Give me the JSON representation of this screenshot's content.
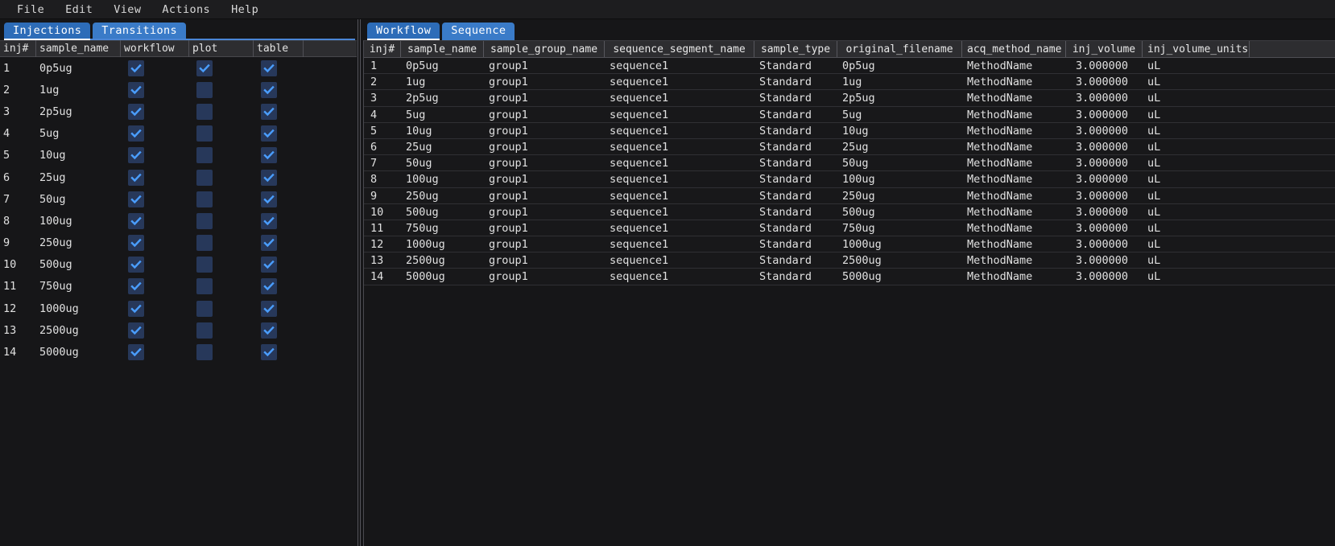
{
  "menubar": {
    "items": [
      "File",
      "Edit",
      "View",
      "Actions",
      "Help"
    ]
  },
  "colors": {
    "window_bg": "#161618",
    "menubar_bg": "#1d1d1f",
    "header_bg": "#2d2d30",
    "tab_active": "#2d6cb8",
    "tab_inactive": "#3a7bc8",
    "accent_line": "#4a86d6",
    "checkbox_bg": "#27385a",
    "check_mark": "#4a9eff",
    "text": "#e0e0e0"
  },
  "left_panel": {
    "tabs": [
      {
        "label": "Injections",
        "active": true
      },
      {
        "label": "Transitions",
        "active": false
      }
    ],
    "table": {
      "columns": [
        "inj#",
        "sample_name",
        "workflow",
        "plot",
        "table"
      ],
      "rows": [
        {
          "inj": "1",
          "sample_name": "0p5ug",
          "workflow": true,
          "plot": true,
          "table": true
        },
        {
          "inj": "2",
          "sample_name": "1ug",
          "workflow": true,
          "plot": false,
          "table": true
        },
        {
          "inj": "3",
          "sample_name": "2p5ug",
          "workflow": true,
          "plot": false,
          "table": true
        },
        {
          "inj": "4",
          "sample_name": "5ug",
          "workflow": true,
          "plot": false,
          "table": true
        },
        {
          "inj": "5",
          "sample_name": "10ug",
          "workflow": true,
          "plot": false,
          "table": true
        },
        {
          "inj": "6",
          "sample_name": "25ug",
          "workflow": true,
          "plot": false,
          "table": true
        },
        {
          "inj": "7",
          "sample_name": "50ug",
          "workflow": true,
          "plot": false,
          "table": true
        },
        {
          "inj": "8",
          "sample_name": "100ug",
          "workflow": true,
          "plot": false,
          "table": true
        },
        {
          "inj": "9",
          "sample_name": "250ug",
          "workflow": true,
          "plot": false,
          "table": true
        },
        {
          "inj": "10",
          "sample_name": "500ug",
          "workflow": true,
          "plot": false,
          "table": true
        },
        {
          "inj": "11",
          "sample_name": "750ug",
          "workflow": true,
          "plot": false,
          "table": true
        },
        {
          "inj": "12",
          "sample_name": "1000ug",
          "workflow": true,
          "plot": false,
          "table": true
        },
        {
          "inj": "13",
          "sample_name": "2500ug",
          "workflow": true,
          "plot": false,
          "table": true
        },
        {
          "inj": "14",
          "sample_name": "5000ug",
          "workflow": true,
          "plot": false,
          "table": true
        }
      ]
    }
  },
  "right_panel": {
    "tabs": [
      {
        "label": "Workflow",
        "active": true
      },
      {
        "label": "Sequence",
        "active": false
      }
    ],
    "table": {
      "columns": [
        "inj#",
        "sample_name",
        "sample_group_name",
        "sequence_segment_name",
        "sample_type",
        "original_filename",
        "acq_method_name",
        "inj_volume",
        "inj_volume_units"
      ],
      "rows": [
        [
          "1",
          "0p5ug",
          "group1",
          "sequence1",
          "Standard",
          "0p5ug",
          "MethodName",
          "3.000000",
          "uL"
        ],
        [
          "2",
          "1ug",
          "group1",
          "sequence1",
          "Standard",
          "1ug",
          "MethodName",
          "3.000000",
          "uL"
        ],
        [
          "3",
          "2p5ug",
          "group1",
          "sequence1",
          "Standard",
          "2p5ug",
          "MethodName",
          "3.000000",
          "uL"
        ],
        [
          "4",
          "5ug",
          "group1",
          "sequence1",
          "Standard",
          "5ug",
          "MethodName",
          "3.000000",
          "uL"
        ],
        [
          "5",
          "10ug",
          "group1",
          "sequence1",
          "Standard",
          "10ug",
          "MethodName",
          "3.000000",
          "uL"
        ],
        [
          "6",
          "25ug",
          "group1",
          "sequence1",
          "Standard",
          "25ug",
          "MethodName",
          "3.000000",
          "uL"
        ],
        [
          "7",
          "50ug",
          "group1",
          "sequence1",
          "Standard",
          "50ug",
          "MethodName",
          "3.000000",
          "uL"
        ],
        [
          "8",
          "100ug",
          "group1",
          "sequence1",
          "Standard",
          "100ug",
          "MethodName",
          "3.000000",
          "uL"
        ],
        [
          "9",
          "250ug",
          "group1",
          "sequence1",
          "Standard",
          "250ug",
          "MethodName",
          "3.000000",
          "uL"
        ],
        [
          "10",
          "500ug",
          "group1",
          "sequence1",
          "Standard",
          "500ug",
          "MethodName",
          "3.000000",
          "uL"
        ],
        [
          "11",
          "750ug",
          "group1",
          "sequence1",
          "Standard",
          "750ug",
          "MethodName",
          "3.000000",
          "uL"
        ],
        [
          "12",
          "1000ug",
          "group1",
          "sequence1",
          "Standard",
          "1000ug",
          "MethodName",
          "3.000000",
          "uL"
        ],
        [
          "13",
          "2500ug",
          "group1",
          "sequence1",
          "Standard",
          "2500ug",
          "MethodName",
          "3.000000",
          "uL"
        ],
        [
          "14",
          "5000ug",
          "group1",
          "sequence1",
          "Standard",
          "5000ug",
          "MethodName",
          "3.000000",
          "uL"
        ]
      ]
    }
  }
}
